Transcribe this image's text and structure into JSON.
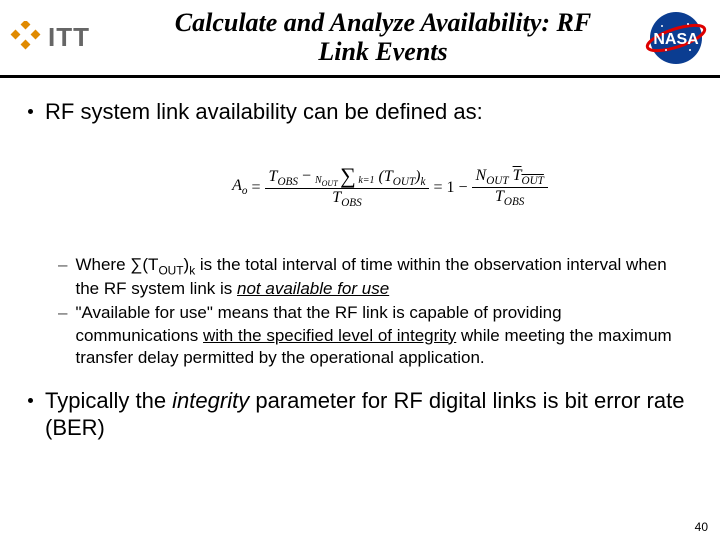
{
  "header": {
    "logo1_alt": "ITT",
    "title_l1": "Calculate and Analyze Availability: RF",
    "title_l2": "Link Events",
    "logo2_alt": "NASA"
  },
  "bullets": {
    "lvl1_a": "RF system link availability can be defined as:",
    "lvl1_b_pre": "Typically the ",
    "lvl1_b_em": "integrity",
    "lvl1_b_post": " parameter for RF digital links is bit error rate (BER)"
  },
  "sub": {
    "a_pre": "Where ∑(T",
    "a_sub1": "OUT",
    "a_mid1": ")",
    "a_sub2": "k",
    "a_mid2": " is the total interval of time within the observation interval when the RF system link is ",
    "a_em": "not available for use",
    "b_pre": "\"Available for use\" means that the RF link is capable of providing communications ",
    "b_u": "with the specified level of integrity",
    "b_post": " while meeting the maximum transfer delay permitted by the operational application."
  },
  "formula": {
    "A": "A",
    "o": "o",
    "eq": " = ",
    "T": "T",
    "OBS": "OBS",
    "minus": " − ",
    "Nout": "N",
    "OUT": "OUT",
    "k1": "k=1",
    "Tout": "T",
    "k": "k",
    "one_minus": " = 1 − ",
    "Tout_bar": "T"
  },
  "page_number": "40"
}
